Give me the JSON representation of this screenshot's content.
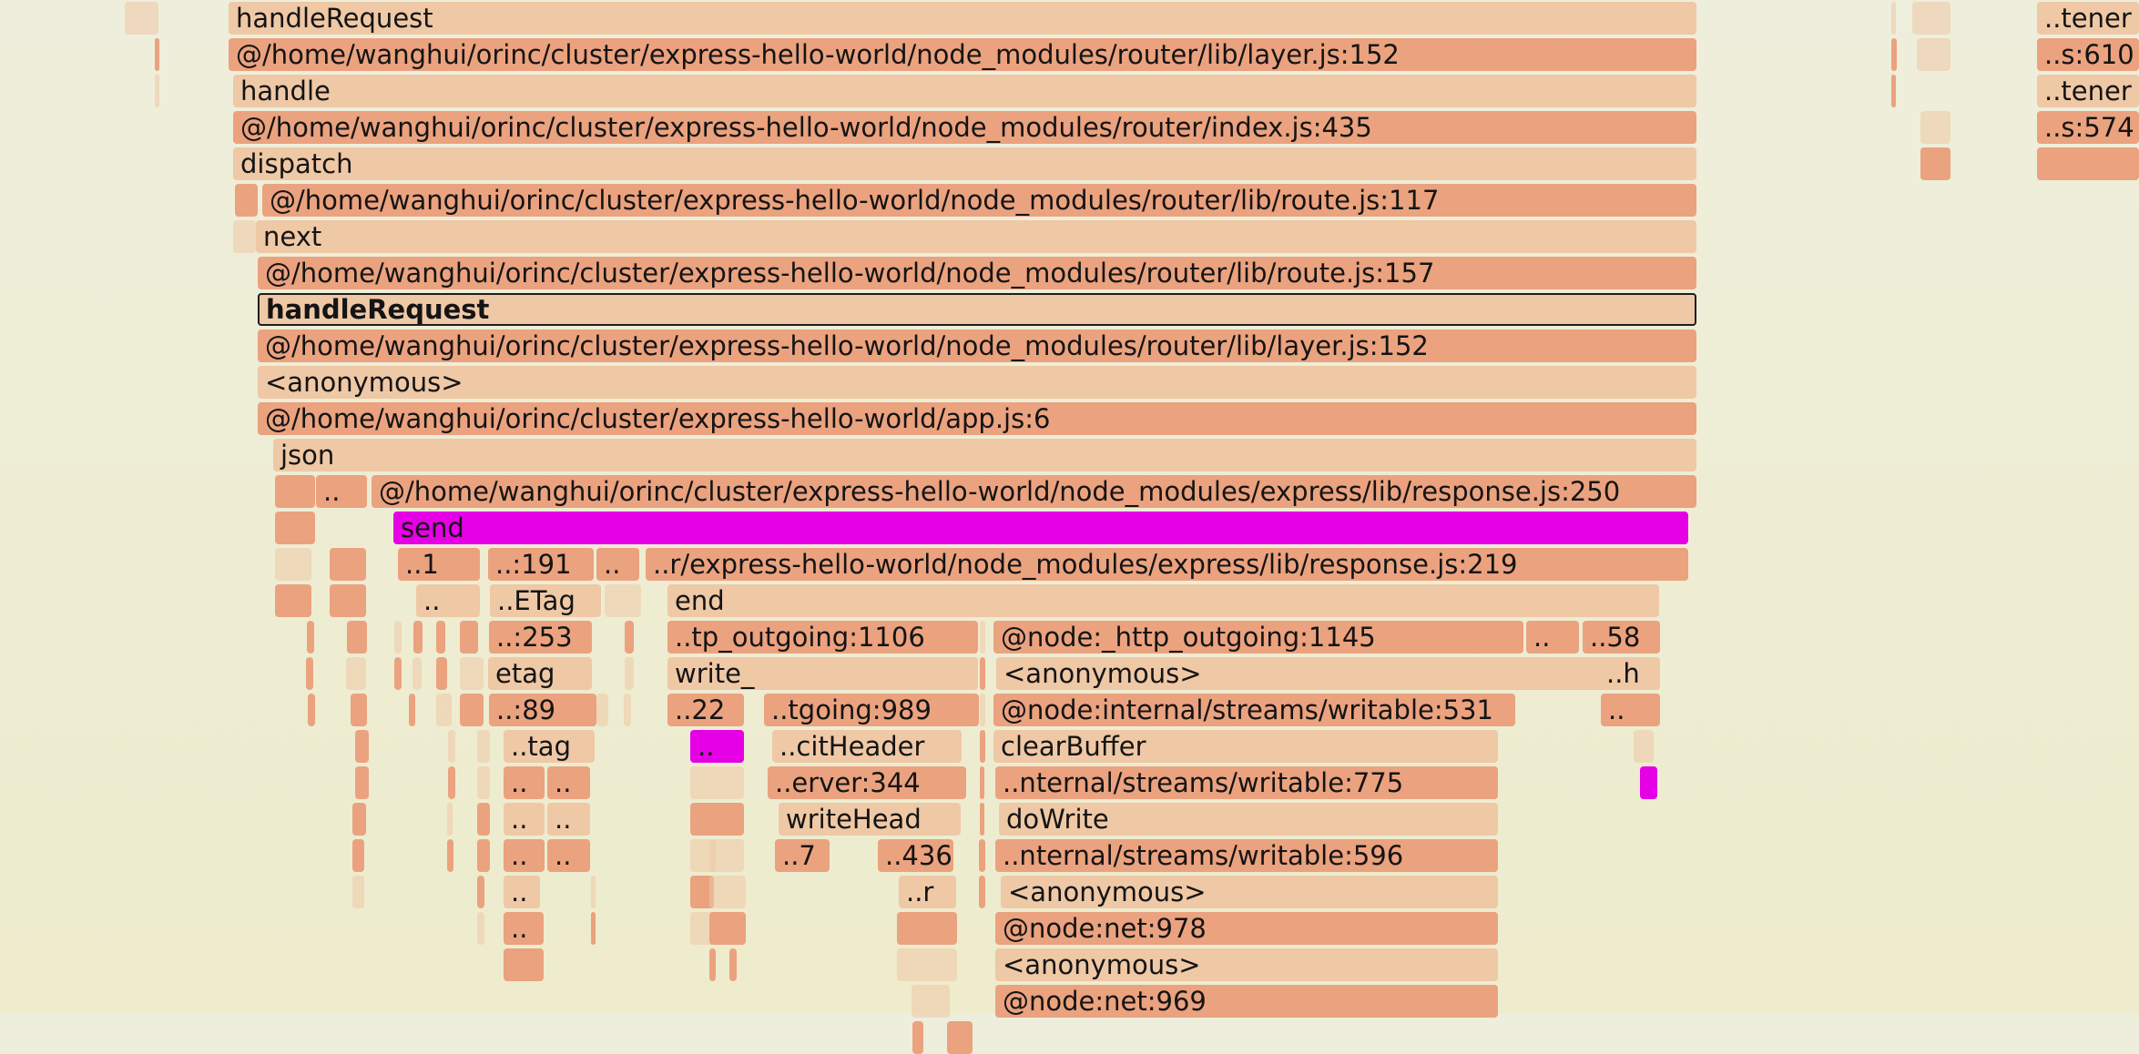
{
  "frames": [
    {
      "label": "handleRequest",
      "col": "c1"
    },
    {
      "label": "@/home/wanghui/orinc/cluster/express-hello-world/node_modules/router/lib/layer.js:152",
      "col": "c2"
    },
    {
      "label": "handle",
      "col": "c1"
    },
    {
      "label": "@/home/wanghui/orinc/cluster/express-hello-world/node_modules/router/index.js:435",
      "col": "c2"
    },
    {
      "label": "dispatch",
      "col": "c1"
    },
    {
      "label": "@/home/wanghui/orinc/cluster/express-hello-world/node_modules/router/lib/route.js:117",
      "col": "c2"
    },
    {
      "label": "next",
      "col": "c1"
    },
    {
      "label": "@/home/wanghui/orinc/cluster/express-hello-world/node_modules/router/lib/route.js:157",
      "col": "c2"
    },
    {
      "label": "handleRequest",
      "col": "c1",
      "selected": true
    },
    {
      "label": "@/home/wanghui/orinc/cluster/express-hello-world/node_modules/router/lib/layer.js:152",
      "col": "c2"
    },
    {
      "label": "<anonymous>",
      "col": "c1"
    },
    {
      "label": "@/home/wanghui/orinc/cluster/express-hello-world/app.js:6",
      "col": "c2"
    },
    {
      "label": "json",
      "col": "c1"
    },
    {
      "label": "..",
      "col": "c2"
    },
    {
      "label": "@/home/wanghui/orinc/cluster/express-hello-world/node_modules/express/lib/response.js:250",
      "col": "c2"
    },
    {
      "label": "send",
      "col": "c3"
    },
    {
      "label": "..1",
      "col": "c2"
    },
    {
      "label": "..:191",
      "col": "c2"
    },
    {
      "label": "..",
      "col": "c2"
    },
    {
      "label": "..r/express-hello-world/node_modules/express/lib/response.js:219",
      "col": "c2"
    },
    {
      "label": "..",
      "col": "c1"
    },
    {
      "label": "..ETag",
      "col": "c1"
    },
    {
      "label": "end",
      "col": "c1"
    },
    {
      "label": "..:253",
      "col": "c2"
    },
    {
      "label": "..tp_outgoing:1106",
      "col": "c2"
    },
    {
      "label": "@node:_http_outgoing:1145",
      "col": "c2"
    },
    {
      "label": "..",
      "col": "c2"
    },
    {
      "label": "..58",
      "col": "c2"
    },
    {
      "label": "etag",
      "col": "c1"
    },
    {
      "label": "write_",
      "col": "c1"
    },
    {
      "label": "<anonymous>",
      "col": "c1"
    },
    {
      "label": "..h",
      "col": "c1"
    },
    {
      "label": "..:89",
      "col": "c2"
    },
    {
      "label": "..22",
      "col": "c2"
    },
    {
      "label": "..tgoing:989",
      "col": "c2"
    },
    {
      "label": "@node:internal/streams/writable:531",
      "col": "c2"
    },
    {
      "label": "..",
      "col": "c2"
    },
    {
      "label": "..tag",
      "col": "c1"
    },
    {
      "label": "..",
      "col": "c3"
    },
    {
      "label": "..citHeader",
      "col": "c1"
    },
    {
      "label": "clearBuffer",
      "col": "c1"
    },
    {
      "label": "..",
      "col": "c2"
    },
    {
      "label": "..",
      "col": "c2"
    },
    {
      "label": "..erver:344",
      "col": "c2"
    },
    {
      "label": "..nternal/streams/writable:775",
      "col": "c2"
    },
    {
      "label": "..",
      "col": "c1"
    },
    {
      "label": "..",
      "col": "c1"
    },
    {
      "label": "writeHead",
      "col": "c1"
    },
    {
      "label": "doWrite",
      "col": "c1"
    },
    {
      "label": "..",
      "col": "c2"
    },
    {
      "label": "..",
      "col": "c2"
    },
    {
      "label": "..7",
      "col": "c2"
    },
    {
      "label": "..436",
      "col": "c2"
    },
    {
      "label": "..nternal/streams/writable:596",
      "col": "c2"
    },
    {
      "label": "..",
      "col": "c1"
    },
    {
      "label": "..r",
      "col": "c1"
    },
    {
      "label": "<anonymous>",
      "col": "c1"
    },
    {
      "label": "..",
      "col": "c2"
    },
    {
      "label": "@node:net:978",
      "col": "c2"
    },
    {
      "label": "<anonymous>",
      "col": "c1"
    },
    {
      "label": "@node:net:969",
      "col": "c2"
    },
    {
      "label": "..tener",
      "col": "c1"
    },
    {
      "label": "..s:610",
      "col": "c2"
    },
    {
      "label": "..tener",
      "col": "c1"
    },
    {
      "label": "..s:574",
      "col": "c2"
    },
    {
      "label": "",
      "col": "c1",
      "faint": true
    },
    {
      "label": "",
      "col": "c2"
    },
    {
      "label": "",
      "col": "c1",
      "faint": true
    },
    {
      "label": "",
      "col": "c2"
    },
    {
      "label": "",
      "col": "c1",
      "faint": true
    },
    {
      "label": "",
      "col": "c1",
      "faint": true
    },
    {
      "label": "",
      "col": "c2"
    },
    {
      "label": "",
      "col": "c1",
      "faint": true
    },
    {
      "label": "",
      "col": "c2"
    },
    {
      "label": "",
      "col": "c1",
      "faint": true
    },
    {
      "label": "",
      "col": "c2"
    },
    {
      "label": "",
      "col": "c2"
    },
    {
      "label": "",
      "col": "c2"
    },
    {
      "label": "",
      "col": "c1",
      "faint": true
    },
    {
      "label": "",
      "col": "c2"
    },
    {
      "label": "",
      "col": "c2"
    },
    {
      "label": "",
      "col": "c1",
      "faint": true
    },
    {
      "label": "",
      "col": "c2"
    },
    {
      "label": "",
      "col": "c2"
    },
    {
      "label": "",
      "col": "c2"
    },
    {
      "label": "",
      "col": "c2"
    },
    {
      "label": "",
      "col": "c2"
    },
    {
      "label": "",
      "col": "c2"
    },
    {
      "label": "",
      "col": "c1",
      "faint": true
    },
    {
      "label": "",
      "col": "c2"
    },
    {
      "label": "",
      "col": "c2"
    },
    {
      "label": "",
      "col": "c2"
    },
    {
      "label": "",
      "col": "c2"
    },
    {
      "label": "",
      "col": "c2"
    },
    {
      "label": "",
      "col": "c2"
    },
    {
      "label": "",
      "col": "c1",
      "faint": true
    },
    {
      "label": "",
      "col": "c1",
      "faint": true
    },
    {
      "label": "",
      "col": "c2"
    },
    {
      "label": "",
      "col": "c2"
    },
    {
      "label": "",
      "col": "c2"
    },
    {
      "label": "",
      "col": "c2"
    },
    {
      "label": "",
      "col": "c1",
      "faint": true
    },
    {
      "label": "",
      "col": "c2"
    },
    {
      "label": "",
      "col": "c1",
      "faint": true
    },
    {
      "label": "",
      "col": "c2"
    },
    {
      "label": "",
      "col": "c1",
      "faint": true
    },
    {
      "label": "",
      "col": "c2"
    },
    {
      "label": "",
      "col": "c1",
      "faint": true
    },
    {
      "label": "",
      "col": "c2"
    },
    {
      "label": "",
      "col": "c1",
      "faint": true
    },
    {
      "label": "",
      "col": "c1",
      "faint": true
    },
    {
      "label": "",
      "col": "c1",
      "faint": true
    },
    {
      "label": "",
      "col": "c1",
      "faint": true
    },
    {
      "label": "",
      "col": "c1",
      "faint": true
    },
    {
      "label": "",
      "col": "c2"
    },
    {
      "label": "",
      "col": "c2"
    },
    {
      "label": "",
      "col": "c2"
    },
    {
      "label": "",
      "col": "c1",
      "faint": true
    },
    {
      "label": "",
      "col": "c2"
    },
    {
      "label": "",
      "col": "c1",
      "faint": true
    },
    {
      "label": "",
      "col": "c2"
    },
    {
      "label": "",
      "col": "c1",
      "faint": true
    },
    {
      "label": "",
      "col": "c2"
    },
    {
      "label": "",
      "col": "c1",
      "faint": true
    },
    {
      "label": "",
      "col": "c2"
    },
    {
      "label": "",
      "col": "c1",
      "faint": true
    },
    {
      "label": "",
      "col": "c2"
    },
    {
      "label": "",
      "col": "c1",
      "faint": true
    },
    {
      "label": "",
      "col": "c1",
      "faint": true
    },
    {
      "label": "",
      "col": "c2"
    },
    {
      "label": "",
      "col": "c1",
      "faint": true
    },
    {
      "label": "",
      "col": "c2"
    },
    {
      "label": "",
      "col": "c2"
    },
    {
      "label": "",
      "col": "c1",
      "faint": true
    },
    {
      "label": "",
      "col": "c2"
    },
    {
      "label": "",
      "col": "c2"
    },
    {
      "label": "",
      "col": "c1",
      "faint": true
    },
    {
      "label": "",
      "col": "c1",
      "faint": true
    },
    {
      "label": "",
      "col": "c2"
    },
    {
      "label": "",
      "col": "c1",
      "faint": true
    },
    {
      "label": "",
      "col": "c2"
    },
    {
      "label": "",
      "col": "c2"
    },
    {
      "label": "",
      "col": "c2"
    },
    {
      "label": "",
      "col": "c2"
    },
    {
      "label": "",
      "col": "c2"
    },
    {
      "label": "",
      "col": "c1",
      "faint": true
    },
    {
      "label": "",
      "col": "c2"
    },
    {
      "label": "",
      "col": "c1",
      "faint": true
    },
    {
      "label": "",
      "col": "c3"
    }
  ]
}
